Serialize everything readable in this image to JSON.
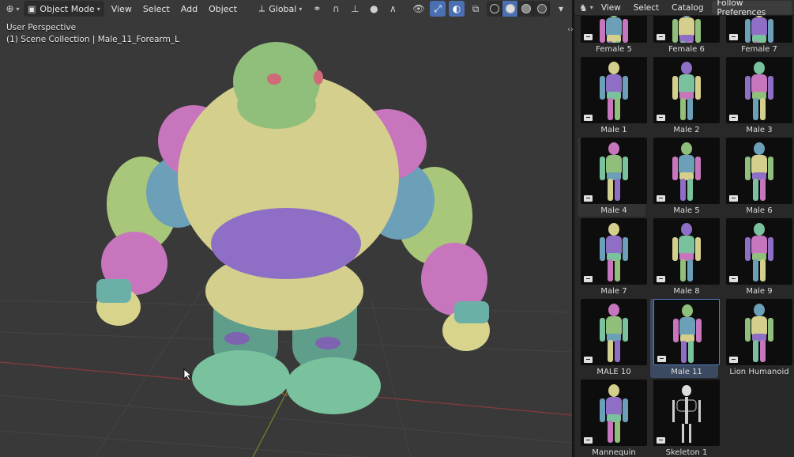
{
  "header": {
    "mode": "Object Mode",
    "menus": [
      "View",
      "Select",
      "Add",
      "Object"
    ],
    "transform_orientation": "Global"
  },
  "viewport": {
    "perspective": "User Perspective",
    "collection_line": "(1) Scene Collection | Male_11_Forearm_L"
  },
  "asset_browser": {
    "menus": [
      "View",
      "Select",
      "Catalog"
    ],
    "follow_prefs": "Follow Preferences",
    "top_row": [
      "Female 5",
      "Female 6",
      "Female 7"
    ],
    "items": [
      "Male 1",
      "Male 2",
      "Male 3",
      "Male 4",
      "Male 5",
      "Male 6",
      "Male 7",
      "Male 8",
      "Male 9",
      "MALE 10",
      "Male 11",
      "Lion Humanoid",
      "Mannequin",
      "Skeleton 1"
    ],
    "selected": "Male 11",
    "hovered": "Male 4"
  },
  "colors": {
    "active_blue": "#4a6fb3",
    "selected_bg": "#3b4a61",
    "grid_red": "#8a3a3a",
    "grid_green": "#6a8a2a"
  }
}
